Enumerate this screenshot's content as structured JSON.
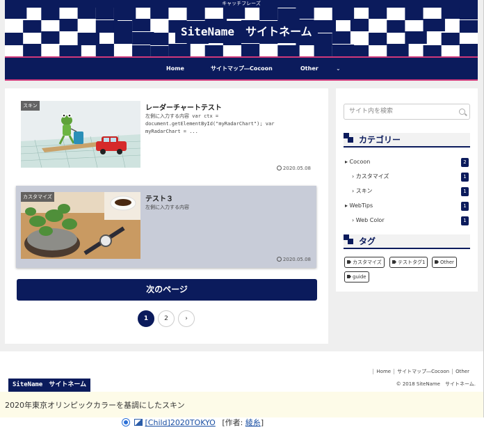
{
  "header": {
    "catchphrase": "キャッチフレーズ",
    "site_title": "SiteName　サイトネーム"
  },
  "nav": {
    "items": [
      {
        "label": "Home"
      },
      {
        "label": "サイトマップ―Cocoon"
      },
      {
        "label": "Other"
      }
    ],
    "dropdown_glyph": "⌄"
  },
  "articles": [
    {
      "badge": "スキン",
      "title": "レーダーチャートテスト",
      "snippet": "左側に入力する内容 var ctx = document.getElementById(\"myRadarChart\"); var myRadarChart = ...",
      "date": "2020.05.08"
    },
    {
      "badge": "カスタマイズ",
      "title": "テスト３",
      "snippet": "左側に入力する内容",
      "date": "2020.05.08"
    }
  ],
  "pagination": {
    "next_label": "次のページ",
    "pages": [
      "1",
      "2"
    ],
    "next_arrow": "›"
  },
  "sidebar": {
    "search_placeholder": "サイト内を検索",
    "category_heading": "カテゴリー",
    "categories": [
      {
        "label": "Cocoon",
        "count": "2",
        "level": 0
      },
      {
        "label": "カスタマイズ",
        "count": "1",
        "level": 1
      },
      {
        "label": "スキン",
        "count": "1",
        "level": 1
      },
      {
        "label": "WebTips",
        "count": "1",
        "level": 0
      },
      {
        "label": "Web Color",
        "count": "1",
        "level": 1
      }
    ],
    "tag_heading": "タグ",
    "tags": [
      {
        "label": "カスタマイズ"
      },
      {
        "label": "テストタグ1"
      },
      {
        "label": "Other"
      },
      {
        "label": "guide"
      }
    ]
  },
  "footer": {
    "links": [
      {
        "label": "Home"
      },
      {
        "label": "サイトマップ―Cocoon"
      },
      {
        "label": "Other"
      }
    ],
    "copyright": "© 2018 SiteName　サイトネーム.",
    "logo": "SiteName　サイトネーム"
  },
  "skin_description": "2020年東京オリンピックカラーを基調にしたスキン",
  "skin_option": {
    "name": "[Child]2020TOKYO",
    "author_prefix": "[作者: ",
    "author": "綾糸",
    "author_suffix": "]"
  },
  "colors": {
    "navy": "#0b1b5c",
    "accent_pink": "#d0387a"
  }
}
